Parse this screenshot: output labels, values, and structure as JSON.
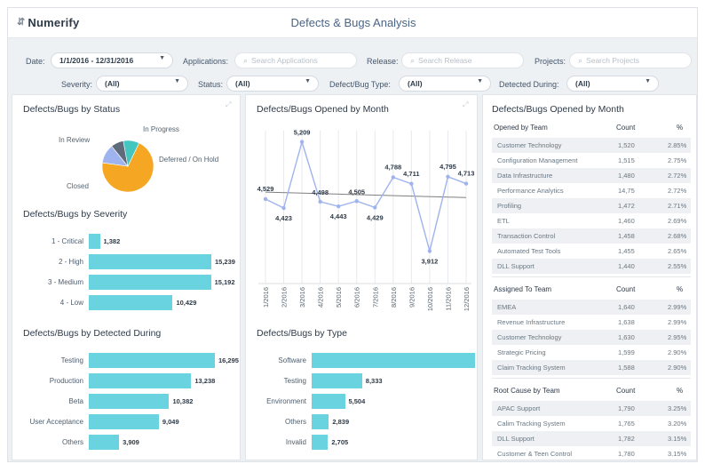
{
  "app": {
    "name": "Numerify",
    "logo_icon": "bars-icon"
  },
  "page_title": "Defects & Bugs Analysis",
  "filters": {
    "date_label": "Date:",
    "date_value": "1/1/2016 - 12/31/2016",
    "applications_label": "Applications:",
    "applications_placeholder": "Search Applications",
    "release_label": "Release:",
    "release_placeholder": "Search Release",
    "projects_label": "Projects:",
    "projects_placeholder": "Search Projects",
    "severity_label": "Severity:",
    "severity_value": "(All)",
    "status_label": "Status:",
    "status_value": "(All)",
    "type_label": "Defect/Bug Type:",
    "type_value": "(All)",
    "detected_label": "Detected During:",
    "detected_value": "(All)"
  },
  "colors": {
    "accent": "#69d3df",
    "line": "#9fb3ee",
    "trend": "#7f7f7f",
    "title": "#4a6486"
  },
  "status_panel": {
    "title": "Defects/Bugs by Status",
    "chart_data": {
      "type": "pie",
      "labels": [
        "Closed",
        "In Review",
        "In Progress",
        "Deferred / On Hold"
      ],
      "values": [
        70,
        12,
        8,
        10
      ],
      "colors": [
        "#f5a623",
        "#9fb3ee",
        "#5f6b7a",
        "#43c6c0",
        "#b85c8c",
        "#8fd18a"
      ]
    }
  },
  "severity_panel": {
    "title": "Defects/Bugs by Severity",
    "chart_data": {
      "type": "bar",
      "categories": [
        "1 - Critical",
        "2 - High",
        "3 - Medium",
        "4 - Low"
      ],
      "values": [
        1382,
        15239,
        15192,
        10429
      ],
      "value_labels": [
        "1,382",
        "15,239",
        "15,192",
        "10,429"
      ]
    }
  },
  "detected_panel": {
    "title": "Defects/Bugs by Detected During",
    "chart_data": {
      "type": "bar",
      "categories": [
        "Testing",
        "Production",
        "Beta",
        "User Acceptance",
        "Others"
      ],
      "values": [
        16295,
        13238,
        10382,
        9049,
        3909
      ],
      "value_labels": [
        "16,295",
        "13,238",
        "10,382",
        "9,049",
        "3,909"
      ]
    }
  },
  "month_panel": {
    "title": "Defects/Bugs Opened by Month",
    "chart_data": {
      "type": "line",
      "x": [
        "1/2016",
        "2/2016",
        "3/2016",
        "4/2016",
        "5/2016",
        "6/2016",
        "7/2016",
        "8/2016",
        "9/2016",
        "10/2016",
        "11/2016",
        "12/2016"
      ],
      "values": [
        4529,
        4423,
        5209,
        4498,
        4443,
        4505,
        4429,
        4788,
        4711,
        3912,
        4795,
        4713
      ],
      "value_labels": [
        "4,529",
        "4,423",
        "5,209",
        "4,498",
        "4,443",
        "4,505",
        "4,429",
        "4,788",
        "4,711",
        "3,912",
        "4,795",
        "4,713"
      ],
      "trend": true
    }
  },
  "type_panel": {
    "title": "Defects/Bugs by Type",
    "chart_data": {
      "type": "bar",
      "categories": [
        "Software",
        "Testing",
        "Environment",
        "Others",
        "Invalid"
      ],
      "values": [
        27000,
        8333,
        5504,
        2839,
        2705
      ],
      "value_labels": [
        "",
        "8,333",
        "5,504",
        "2,839",
        "2,705"
      ]
    }
  },
  "opened_panel": {
    "title": "Defects/Bugs Opened by Month",
    "sections": [
      {
        "header": [
          "Opened by Team",
          "Count",
          "%"
        ],
        "rows": [
          [
            "Customer Technology",
            "1,520",
            "2.85%"
          ],
          [
            "Configuration Management",
            "1,515",
            "2.75%"
          ],
          [
            "Data Infrastructure",
            "1,480",
            "2.72%"
          ],
          [
            "Performance Analytics",
            "14,75",
            "2.72%"
          ],
          [
            "Profiling",
            "1,472",
            "2.71%"
          ],
          [
            "ETL",
            "1,460",
            "2.69%"
          ],
          [
            "Transaction Control",
            "1,458",
            "2.68%"
          ],
          [
            "Automated Test Tools",
            "1,455",
            "2.65%"
          ],
          [
            "DLL Support",
            "1,440",
            "2.55%"
          ]
        ]
      },
      {
        "header": [
          "Assigned To Team",
          "Count",
          "%"
        ],
        "rows": [
          [
            "EMEA",
            "1,640",
            "2.99%"
          ],
          [
            "Revenue Infrastructure",
            "1,638",
            "2.99%"
          ],
          [
            "Customer Technology",
            "1,630",
            "2.95%"
          ],
          [
            "Strategic Pricing",
            "1,599",
            "2.90%"
          ],
          [
            "Claim Tracking System",
            "1,588",
            "2.90%"
          ]
        ]
      },
      {
        "header": [
          "Root Cause by Team",
          "Count",
          "%"
        ],
        "rows": [
          [
            "APAC Support",
            "1,790",
            "3.25%"
          ],
          [
            "Calim Tracking System",
            "1,765",
            "3.20%"
          ],
          [
            "DLL Support",
            "1,782",
            "3.15%"
          ],
          [
            "Customer & Teen Control",
            "1,780",
            "3.15%"
          ]
        ]
      }
    ]
  }
}
